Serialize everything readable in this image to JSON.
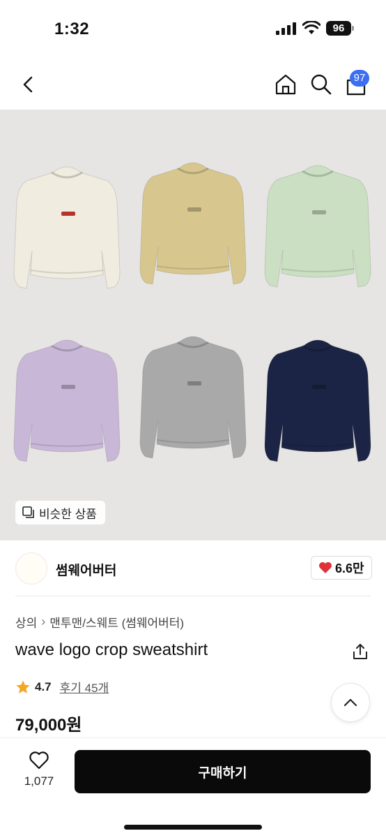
{
  "status_bar": {
    "time": "1:32",
    "battery": "96"
  },
  "nav": {
    "back_icon": "chevron-left-icon",
    "home_icon": "home-icon",
    "search_icon": "search-icon",
    "cart_icon": "cart-icon",
    "cart_badge": "97"
  },
  "product_image": {
    "sweatshirt_colors": [
      "#f0ecdf",
      "#d7c78f",
      "#cbe0c2",
      "#c9b7d8",
      "#a9a9a9",
      "#1c2445"
    ],
    "similar_label": "비슷한 상품"
  },
  "store": {
    "name": "썸웨어버터",
    "likes": "6.6만"
  },
  "breadcrumb": {
    "category": "상의",
    "subcategory": "맨투맨/스웨트 (썸웨어버터)"
  },
  "product": {
    "title": "wave logo crop sweatshirt",
    "rating": "4.7",
    "reviews": "후기 45개",
    "price": "79,000원"
  },
  "bottom_bar": {
    "wish_count": "1,077",
    "buy_label": "구매하기"
  },
  "colors": {
    "accent_badge": "#3b6ef0",
    "heart": "#e0313b",
    "star": "#f5a623",
    "buy_button": "#0a0a0a"
  }
}
